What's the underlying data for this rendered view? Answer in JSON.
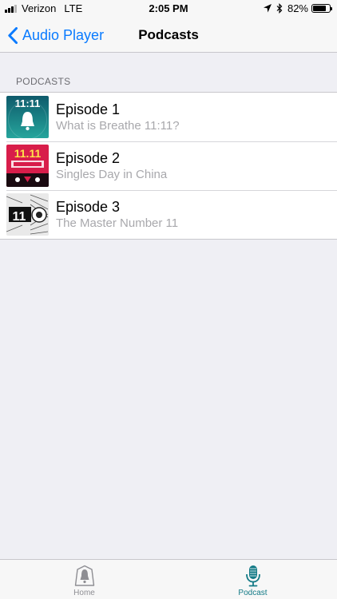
{
  "status_bar": {
    "carrier": "Verizon",
    "network": "LTE",
    "time": "2:05 PM",
    "battery_percent": "82%",
    "battery_level": 0.82
  },
  "nav": {
    "back_label": "Audio Player",
    "title": "Podcasts"
  },
  "section": {
    "header": "PODCASTS"
  },
  "episodes": [
    {
      "title": "Episode 1",
      "subtitle": "What is Breathe 11:11?",
      "art_text": "11:11"
    },
    {
      "title": "Episode 2",
      "subtitle": "Singles Day in China",
      "art_text": "11.11"
    },
    {
      "title": "Episode 3",
      "subtitle": "The Master Number 11",
      "art_text": "11"
    }
  ],
  "tabs": [
    {
      "label": "Home",
      "icon": "bell-icon",
      "selected": false
    },
    {
      "label": "Podcast",
      "icon": "microphone-icon",
      "selected": true
    }
  ],
  "colors": {
    "accent": "#0a7bff",
    "tab_selected": "#137a86",
    "tab_unselected": "#8e8e93",
    "episode1_art": "#1a8f8a",
    "episode2_art": "#d81d4a"
  }
}
